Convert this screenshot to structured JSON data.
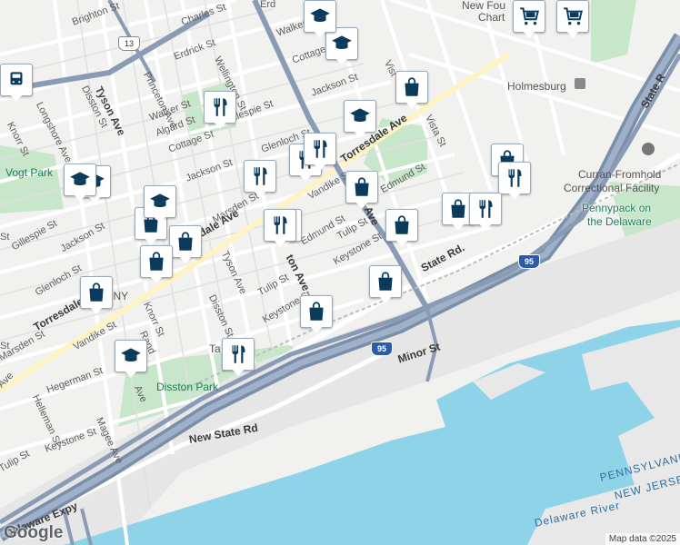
{
  "map": {
    "colors": {
      "land": "#f1f1ef",
      "water": "#8fd3e8",
      "park": "#c8e6c9",
      "highway": "#8a9cb5",
      "arterial": "#ffffff",
      "pin_icon": "#0b3b5c"
    },
    "labels": {
      "neighborhoods": {
        "tacony": "TACONY",
        "holmesburg": "Holmesburg"
      },
      "parks": {
        "vogt_park": "Vogt Park",
        "disston_park": "Disston Park",
        "pennypack_1": "Pennypack on",
        "pennypack_2": "the Delaware"
      },
      "places": {
        "new_foundations_1": "New Fou",
        "new_foundations_2": "Chart",
        "curran_1": "Curran-Fromhold",
        "curran_2": "Correctional Facility"
      },
      "water": {
        "delaware_river": "Delaware River",
        "pennsylvania": "PENNSYLVANIA",
        "new_jersey": "NEW JERSEY"
      },
      "streets": {
        "brighton": "Brighton St",
        "charles": "Charles St",
        "princeton": "Princeton Ave",
        "erdrick": "Erdrick St",
        "wellington": "Wellington St",
        "tyson": "Tyson Ave",
        "disston": "Disston St",
        "longshore": "Longshore Ave",
        "knorr_top": "Knorr St",
        "walker": "Walker St",
        "algard": "Algard St",
        "cottage": "Cottage St",
        "gillespie": "Gillespie St",
        "jackson": "Jackson St",
        "glenloch": "Glenloch St",
        "walker_ne": "Walker St",
        "cottage_ne": "Cottage",
        "jackson_ne": "Jackson St",
        "torresdale": "Torresdale Ave",
        "vista": "Vista St",
        "vista2": "Vist",
        "edmund": "Edmund St",
        "marsden": "Marsden St",
        "vandike": "Vandike St",
        "tulip": "Tulip St",
        "keystone": "Keystone St",
        "state_rd": "State Rd.",
        "state_rd_right": "State R",
        "new_state_rd": "New State Rd",
        "minor": "Minor St",
        "hegerman": "Hegerman St",
        "helleman": "Helleman St",
        "magee": "Magee Ave",
        "rand": "Rand",
        "delaware_expy": "Delaware Expy",
        "gillespie_w": "Gillespie St",
        "jackson_w": "Jackson St",
        "glenloch_w": "Glenloch St",
        "torresdale_w": "Torresdale Ave",
        "marsden_w": "Marsden St",
        "vandike_w": "Vandike St",
        "knorr_w": "Knorr St",
        "keystone_w": "Keystone St",
        "tulip_w": "Tulip St",
        "disston_w": "Disston St",
        "tyson_w": "Tyson Ave",
        "knorr_far": "Knorr",
        "erd": "Erd",
        "st_far": "St",
        "ta": "Ta",
        "ave": "Ave",
        "ep": "ep",
        "ton_ave": "ton Ave",
        "dev": "Dev",
        "ave2": "Ave",
        "keystone_mid": "Keystone St"
      },
      "shields": {
        "route13": "13",
        "i95_a": "95",
        "i95_b": "95"
      }
    },
    "pins": [
      {
        "type": "shopping-bag",
        "name": "pin-shop-1"
      },
      {
        "type": "shopping-bag",
        "name": "pin-shop-2"
      },
      {
        "type": "shopping-bag",
        "name": "pin-shop-3"
      },
      {
        "type": "shopping-bag",
        "name": "pin-shop-4"
      },
      {
        "type": "shopping-bag",
        "name": "pin-shop-5"
      },
      {
        "type": "shopping-bag",
        "name": "pin-shop-6"
      },
      {
        "type": "shopping-bag",
        "name": "pin-shop-7"
      },
      {
        "type": "shopping-bag",
        "name": "pin-shop-8"
      },
      {
        "type": "shopping-bag",
        "name": "pin-shop-9"
      },
      {
        "type": "shopping-bag",
        "name": "pin-shop-10"
      },
      {
        "type": "shopping-bag",
        "name": "pin-shop-11"
      },
      {
        "type": "restaurant",
        "name": "pin-food-1"
      },
      {
        "type": "restaurant",
        "name": "pin-food-2"
      },
      {
        "type": "restaurant",
        "name": "pin-food-3"
      },
      {
        "type": "restaurant",
        "name": "pin-food-4"
      },
      {
        "type": "restaurant",
        "name": "pin-food-5"
      },
      {
        "type": "restaurant",
        "name": "pin-food-6"
      },
      {
        "type": "restaurant",
        "name": "pin-food-7"
      },
      {
        "type": "restaurant",
        "name": "pin-food-8"
      },
      {
        "type": "restaurant",
        "name": "pin-food-9"
      },
      {
        "type": "school",
        "name": "pin-school-1"
      },
      {
        "type": "school",
        "name": "pin-school-2"
      },
      {
        "type": "school",
        "name": "pin-school-3"
      },
      {
        "type": "school",
        "name": "pin-school-4"
      },
      {
        "type": "school",
        "name": "pin-school-5"
      },
      {
        "type": "school",
        "name": "pin-school-6"
      },
      {
        "type": "school",
        "name": "pin-school-7"
      },
      {
        "type": "grocery-cart",
        "name": "pin-grocery-1"
      },
      {
        "type": "grocery-cart",
        "name": "pin-grocery-2"
      },
      {
        "type": "train",
        "name": "pin-train-1"
      }
    ],
    "footer": {
      "logo": "Google",
      "attribution": "Map data ©2025"
    }
  }
}
